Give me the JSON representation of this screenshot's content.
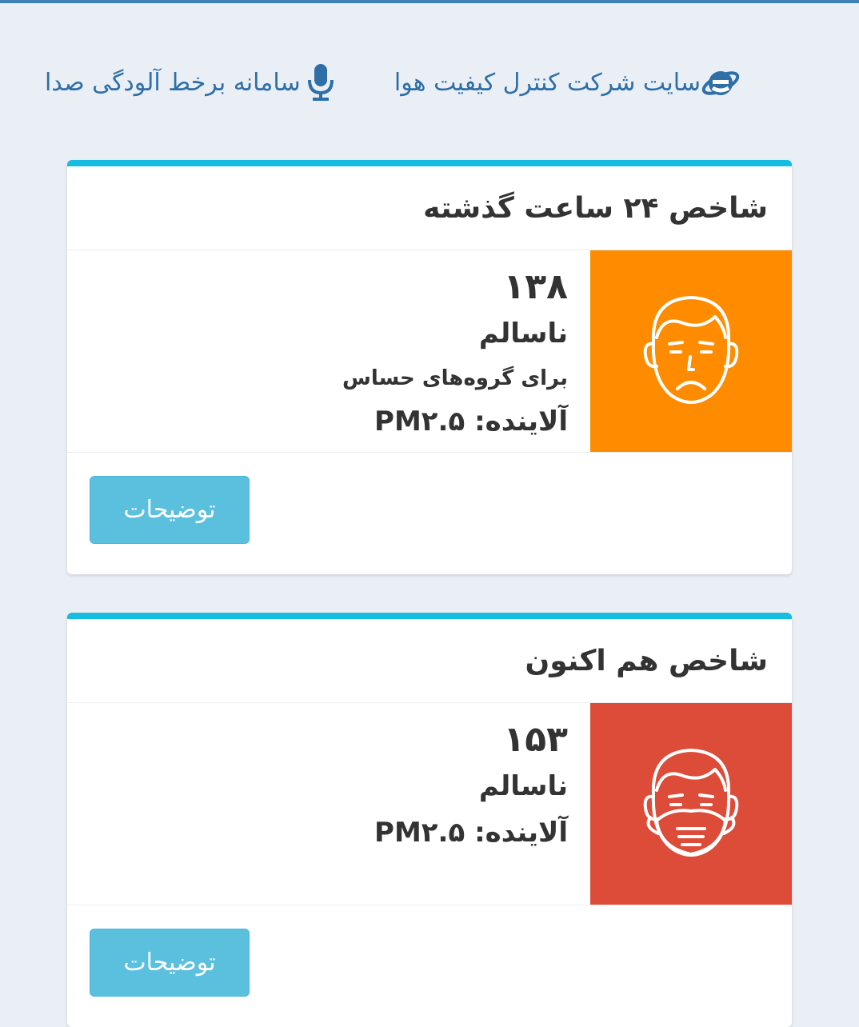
{
  "links": {
    "air_quality_site": "سایت شرکت کنترل کیفیت هوا",
    "noise_pollution_system": "سامانه برخط آلودگی صدا"
  },
  "icons": {
    "air_quality_site": "ie-browser-icon",
    "noise_pollution_system": "microphone-icon"
  },
  "cards": [
    {
      "title": "شاخص ۲۴ ساعت گذشته",
      "aqi": "۱۳۸",
      "status": "ناسالم",
      "note": "برای گروه‌های حساس",
      "pollutant": "آلاینده: PM۲.۵",
      "button": "توضیحات",
      "color": "#ff8c00",
      "icon": "sad-face-icon"
    },
    {
      "title": "شاخص هم اکنون",
      "aqi": "۱۵۳",
      "status": "ناسالم",
      "pollutant": "آلاینده: PM۲.۵",
      "button": "توضیحات",
      "color": "#dd4b39",
      "icon": "face-mask-icon"
    }
  ]
}
